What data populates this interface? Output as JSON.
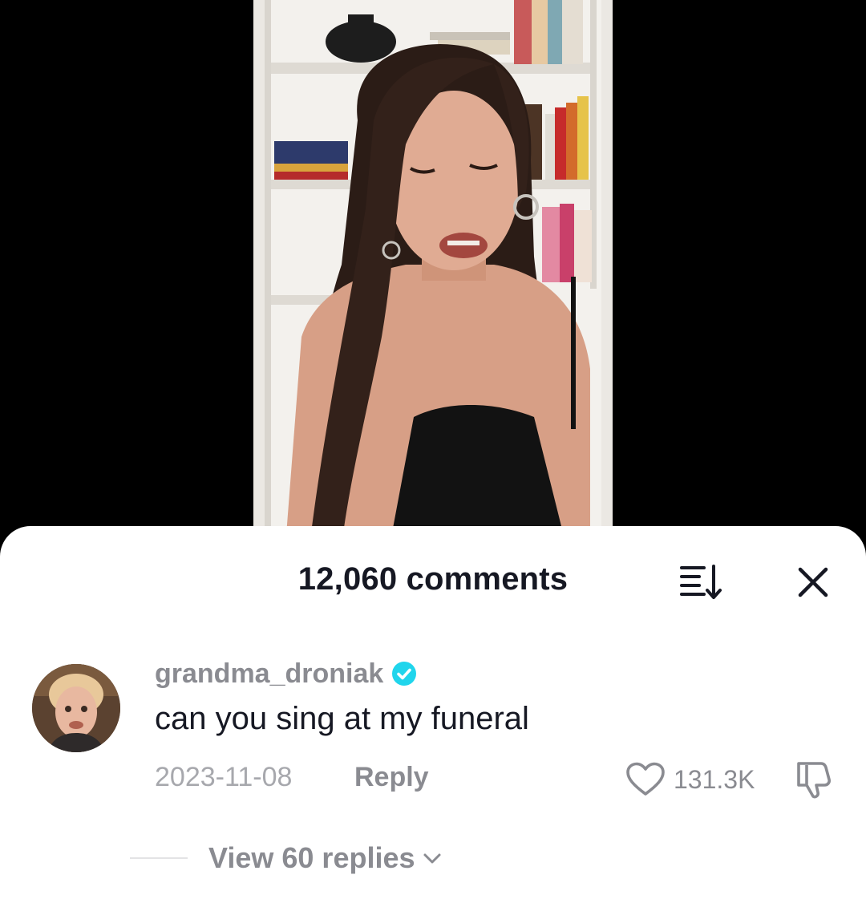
{
  "comments_panel": {
    "title": "12,060 comments",
    "sort_icon": "sort-descending-icon",
    "close_icon": "close-icon"
  },
  "comment": {
    "avatar_icon": "avatar",
    "username": "grandma_droniak",
    "verified_icon": "verified-badge-icon",
    "text": "can you sing at my funeral",
    "date": "2023-11-08",
    "reply_label": "Reply",
    "like_count": "131.3K",
    "like_icon": "heart-outline-icon",
    "dislike_icon": "thumbs-down-icon"
  },
  "replies": {
    "label": "View 60 replies",
    "icon": "chevron-down-icon"
  },
  "colors": {
    "background": "#000000",
    "sheet": "#ffffff",
    "primary_text": "#161823",
    "secondary_text": "#8a8b91",
    "verified": "#20d5ec"
  }
}
